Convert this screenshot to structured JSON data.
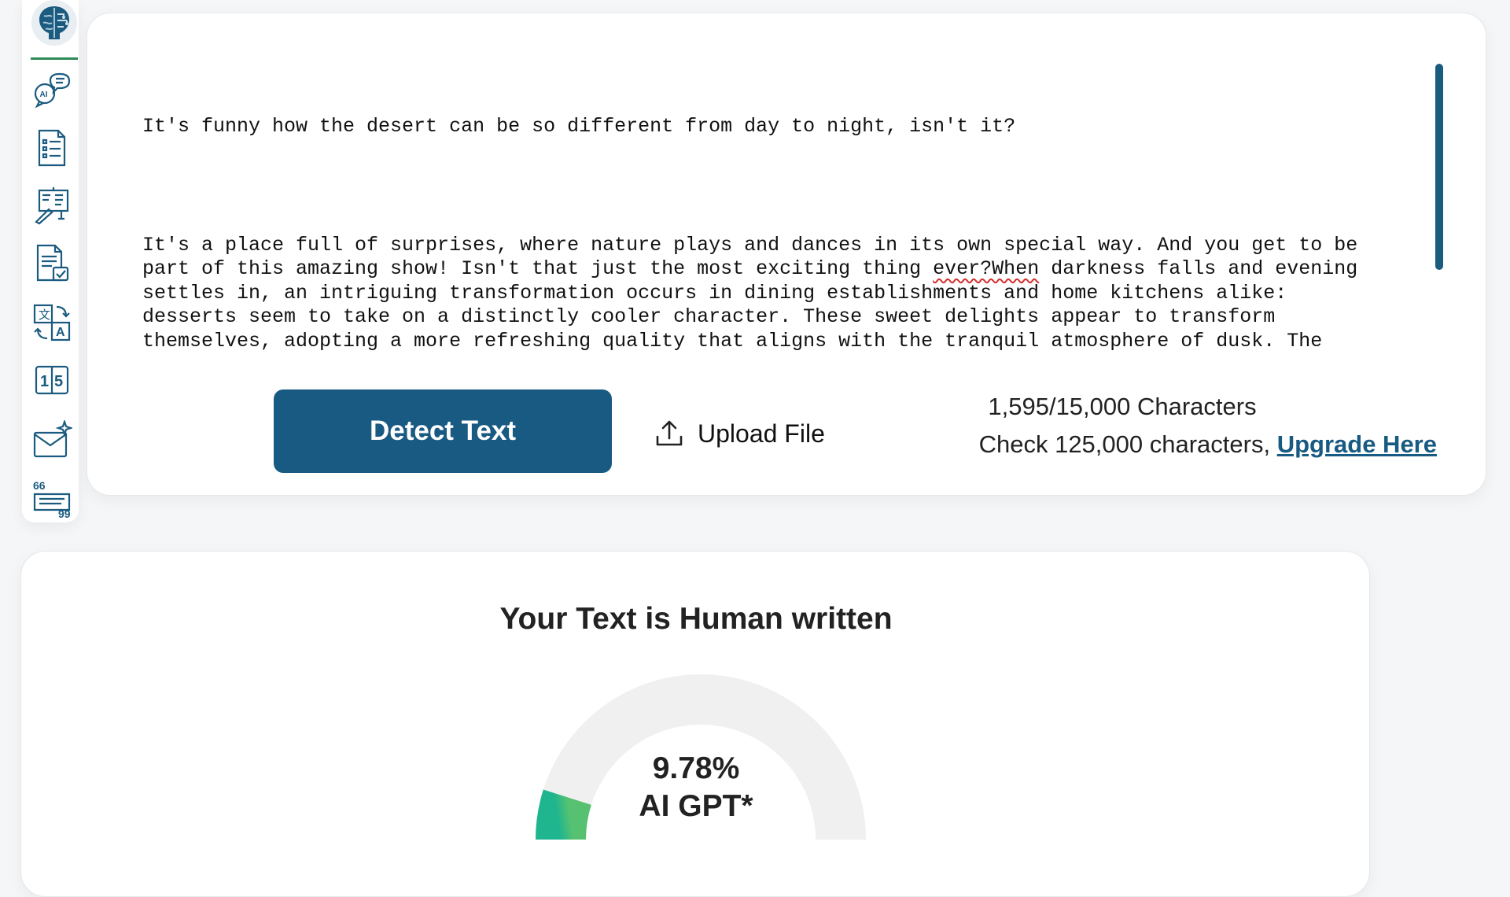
{
  "sidebar": {
    "logo": "brain-logo",
    "items": [
      {
        "name": "ai-chat-icon"
      },
      {
        "name": "document-list-icon"
      },
      {
        "name": "presentation-edit-icon"
      },
      {
        "name": "document-check-icon"
      },
      {
        "name": "translate-icon"
      },
      {
        "name": "number-converter-icon"
      },
      {
        "name": "email-sparkle-icon"
      },
      {
        "name": "quote-icon"
      }
    ]
  },
  "editor": {
    "line1": "It's funny how the desert can be so different from day to night, isn't it?",
    "para2_before": "It's a place full of surprises, where nature plays and dances in its own special way. And you get to be part of this amazing show! Isn't that just the most exciting thing ",
    "para2_misspelled": "ever?When",
    "para2_after": " darkness falls and evening settles in, an intriguing transformation occurs in dining establishments and home kitchens alike: desserts seem to take on a distinctly cooler character. These sweet delights appear to transform themselves, adopting a more refreshing quality that aligns with the tranquil atmosphere of dusk. The warmth accumulated in our bodies throughout the day might explain why these treats feel especially cool against our palates. Alternatively, the interplay between our warm indoor spaces and the brisk evening air could heighten our sensitivity to temperature, making ordinary desserts feel unexpectedly cool.",
    "detect_label": "Detect Text",
    "upload_label": "Upload File",
    "char_count": "1,595/15,000 Characters",
    "upgrade_prefix": "Check 125,000 characters, ",
    "upgrade_link": "Upgrade Here"
  },
  "result": {
    "title": "Your Text is Human written",
    "percent_text": "9.78%",
    "percent_value": 9.78,
    "label": "AI GPT*",
    "gauge_track_color": "#f0f0f0",
    "gauge_fill_start": "#1fb58f",
    "gauge_fill_end": "#56c271"
  },
  "colors": {
    "primary": "#185a82",
    "accent_green": "#2e8b57"
  }
}
